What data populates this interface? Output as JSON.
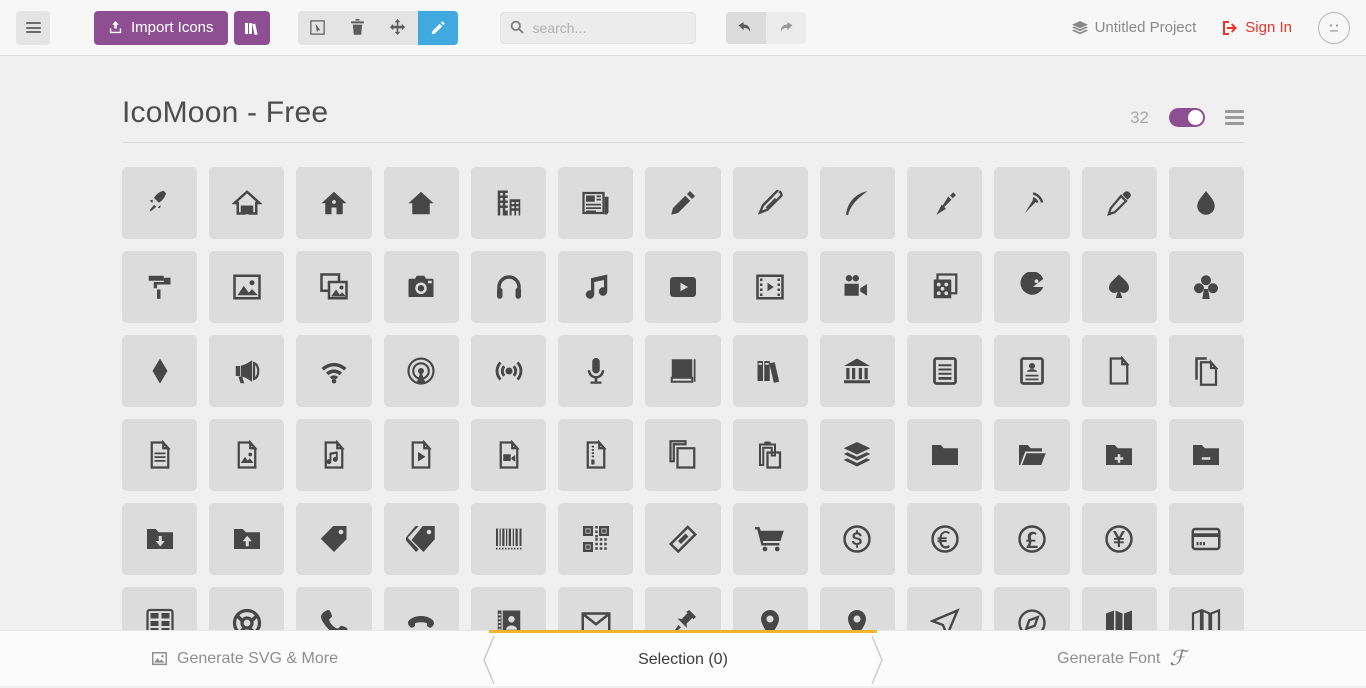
{
  "toolbar": {
    "menu_icon": "hamburger-menu-icon",
    "import_label": "Import Icons",
    "import_icon": "upload-icon",
    "library_icon": "books-icon",
    "tools": [
      {
        "name": "select-tool",
        "icon": "cursor-select-icon",
        "active": false
      },
      {
        "name": "delete-tool",
        "icon": "trash-icon",
        "active": false
      },
      {
        "name": "move-tool",
        "icon": "move-arrows-icon",
        "active": false
      },
      {
        "name": "edit-tool",
        "icon": "pencil-icon",
        "active": true
      }
    ],
    "search": {
      "value": "",
      "placeholder": "search...",
      "icon": "search-icon"
    },
    "undo": {
      "icon": "undo-arrow-icon",
      "enabled": true
    },
    "redo": {
      "icon": "redo-arrow-icon",
      "enabled": false
    },
    "project_label": "Untitled Project",
    "project_icon": "stack-layers-icon",
    "signin_label": "Sign In",
    "signin_icon": "login-enter-icon",
    "avatar_icon": "neutral-face-icon",
    "accent_purple": "#8d4f92",
    "accent_blue": "#3fa9e0",
    "accent_red": "#e8332a"
  },
  "iconset": {
    "title": "IcoMoon - Free",
    "count": "32",
    "toggle_on": true,
    "menu_icon": "set-menu-icon"
  },
  "grid": {
    "rows": [
      [
        "rocket-icon",
        "home-icon",
        "home2-icon",
        "home3-icon",
        "office-icon",
        "newspaper-icon",
        "pencil-icon",
        "pencil2-icon",
        "quill-icon",
        "pen-icon",
        "blog-icon",
        "eyedropper-icon",
        "droplet-icon"
      ],
      [
        "paint-format-icon",
        "image-icon",
        "images-icon",
        "camera-icon",
        "headphones-icon",
        "music-icon",
        "play-icon",
        "film-icon",
        "video-camera-icon",
        "dice-icon",
        "pacman-icon",
        "spades-icon",
        "clubs-icon"
      ],
      [
        "diamonds-icon",
        "bullhorn-icon",
        "connection-icon",
        "podcast-icon",
        "feed-icon",
        "mic-icon",
        "book-icon",
        "books-icon",
        "library-icon",
        "file-text-icon",
        "profile-icon",
        "file-empty-icon",
        "files-empty-icon"
      ],
      [
        "file-text2-icon",
        "file-picture-icon",
        "file-music-icon",
        "file-play-icon",
        "file-video-icon",
        "file-zip-icon",
        "copy-icon",
        "paste-icon",
        "stack-icon",
        "folder-icon",
        "folder-open-icon",
        "folder-plus-icon",
        "folder-minus-icon"
      ],
      [
        "folder-download-icon",
        "folder-upload-icon",
        "price-tag-icon",
        "price-tags-icon",
        "barcode-icon",
        "qrcode-icon",
        "ticket-icon",
        "cart-icon",
        "coin-dollar-icon",
        "coin-euro-icon",
        "coin-pound-icon",
        "coin-yen-icon",
        "credit-card-icon"
      ],
      [
        "calculator-icon",
        "lifebuoy-icon",
        "phone-icon",
        "phone-hang-up-icon",
        "address-book-icon",
        "envelop-icon",
        "pushpin-icon",
        "location-icon",
        "location2-icon",
        "compass-icon",
        "compass2-icon",
        "map-icon",
        "map2-icon"
      ]
    ]
  },
  "footer": {
    "left_label": "Generate SVG & More",
    "left_icon": "image-icon",
    "center_label": "Selection (0)",
    "right_label": "Generate Font",
    "right_icon": "font-f-icon",
    "accent_orange": "#f7b32b"
  }
}
